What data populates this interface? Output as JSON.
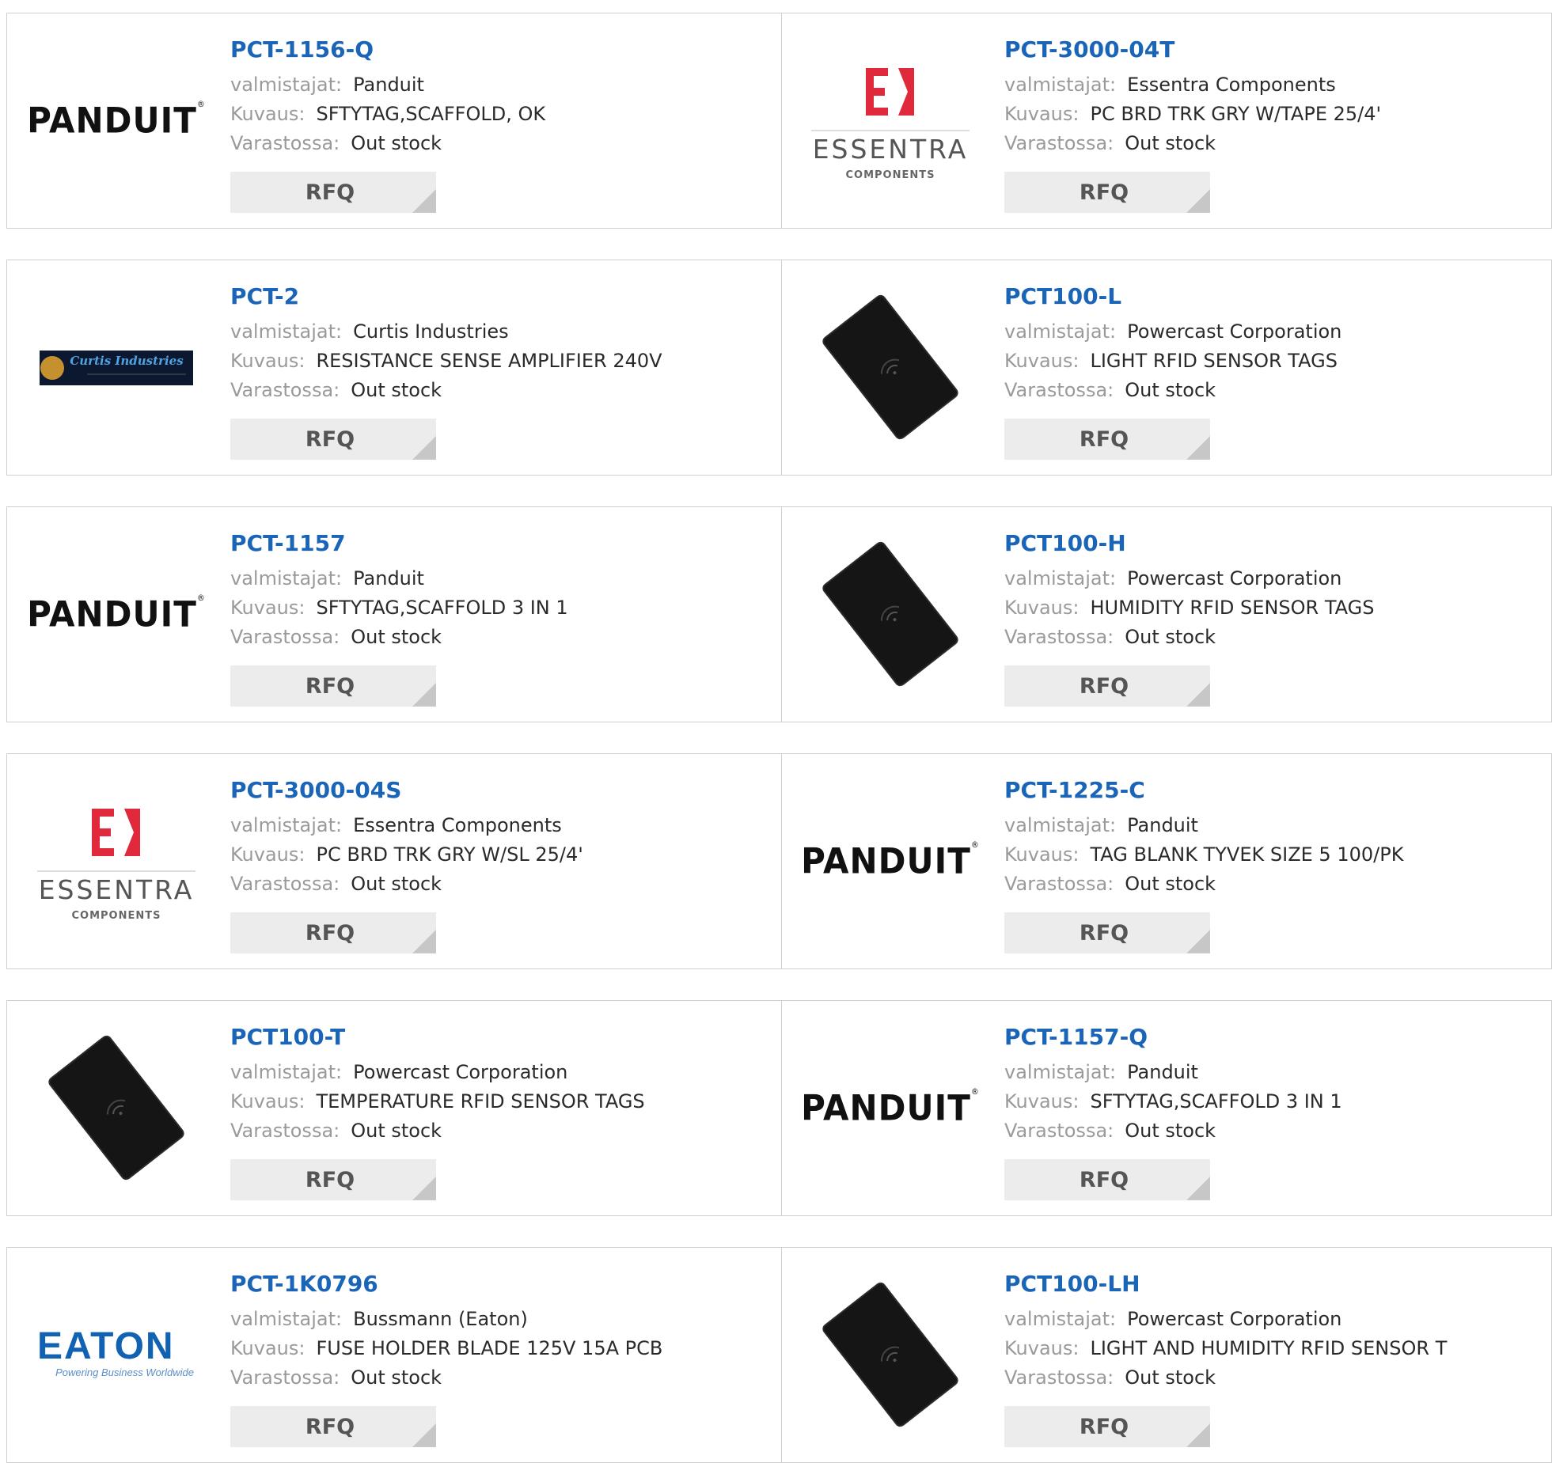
{
  "labels": {
    "manufacturer": "valmistajat:",
    "description": "Kuvaus:",
    "stock": "Varastossa:",
    "rfq": "RFQ"
  },
  "colors": {
    "title": "#1a65b8",
    "label": "#9a9a9a",
    "value": "#2a2a2a",
    "border": "#cfcfcf",
    "rfq_bg": "#ececec"
  },
  "products": [
    {
      "part": "PCT-1156-Q",
      "manufacturer": "Panduit",
      "description": "SFTYTAG,SCAFFOLD, OK",
      "stock": "Out stock",
      "logo": "panduit-logo",
      "logo_text": "PANDUIT"
    },
    {
      "part": "PCT-3000-04T",
      "manufacturer": "Essentra Components",
      "description": "PC BRD TRK GRY W/TAPE 25/4'",
      "stock": "Out stock",
      "logo": "essentra-logo",
      "logo_text": "ESSENTRA",
      "logo_sub": "COMPONENTS"
    },
    {
      "part": "PCT-2",
      "manufacturer": "Curtis Industries",
      "description": "RESISTANCE SENSE AMPLIFIER 240V",
      "stock": "Out stock",
      "logo": "curtis-logo",
      "logo_text": "Curtis Industries"
    },
    {
      "part": "PCT100-L",
      "manufacturer": "Powercast Corporation",
      "description": "LIGHT RFID SENSOR TAGS",
      "stock": "Out stock",
      "logo": "rfid-tag-image"
    },
    {
      "part": "PCT-1157",
      "manufacturer": "Panduit",
      "description": "SFTYTAG,SCAFFOLD 3 IN 1",
      "stock": "Out stock",
      "logo": "panduit-logo",
      "logo_text": "PANDUIT"
    },
    {
      "part": "PCT100-H",
      "manufacturer": "Powercast Corporation",
      "description": "HUMIDITY RFID SENSOR TAGS",
      "stock": "Out stock",
      "logo": "rfid-tag-image"
    },
    {
      "part": "PCT-3000-04S",
      "manufacturer": "Essentra Components",
      "description": "PC BRD TRK GRY W/SL 25/4'",
      "stock": "Out stock",
      "logo": "essentra-logo",
      "logo_text": "ESSENTRA",
      "logo_sub": "COMPONENTS"
    },
    {
      "part": "PCT-1225-C",
      "manufacturer": "Panduit",
      "description": "TAG BLANK TYVEK SIZE 5 100/PK",
      "stock": "Out stock",
      "logo": "panduit-logo",
      "logo_text": "PANDUIT"
    },
    {
      "part": "PCT100-T",
      "manufacturer": "Powercast Corporation",
      "description": "TEMPERATURE RFID SENSOR TAGS",
      "stock": "Out stock",
      "logo": "rfid-tag-image"
    },
    {
      "part": "PCT-1157-Q",
      "manufacturer": "Panduit",
      "description": "SFTYTAG,SCAFFOLD 3 IN 1",
      "stock": "Out stock",
      "logo": "panduit-logo",
      "logo_text": "PANDUIT"
    },
    {
      "part": "PCT-1K0796",
      "manufacturer": "Bussmann (Eaton)",
      "description": "FUSE HOLDER BLADE 125V 15A PCB",
      "stock": "Out stock",
      "logo": "eaton-logo",
      "logo_text": "EATON",
      "logo_sub": "Powering Business Worldwide"
    },
    {
      "part": "PCT100-LH",
      "manufacturer": "Powercast Corporation",
      "description": "LIGHT AND HUMIDITY RFID SENSOR T",
      "stock": "Out stock",
      "logo": "rfid-tag-image"
    }
  ]
}
